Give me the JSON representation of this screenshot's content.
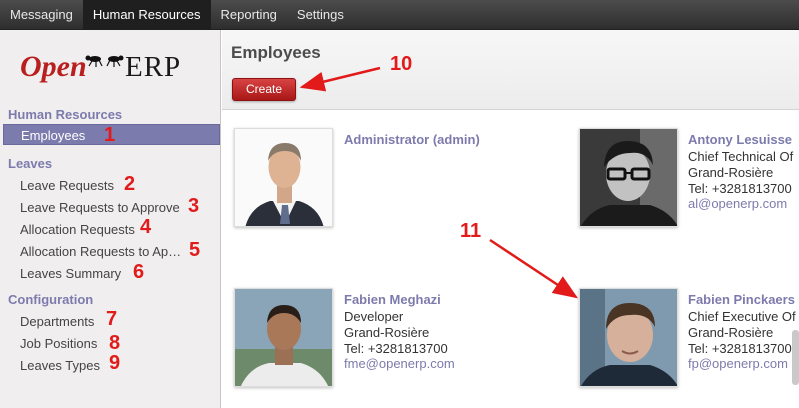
{
  "topbar": {
    "items": [
      {
        "label": "Messaging"
      },
      {
        "label": "Human Resources"
      },
      {
        "label": "Reporting"
      },
      {
        "label": "Settings"
      }
    ]
  },
  "logo": {
    "open": "Open",
    "erp": "ERP"
  },
  "sidebar": {
    "sections": [
      {
        "title": "Human Resources",
        "items": [
          {
            "label": "Employees",
            "marker": "1"
          }
        ]
      },
      {
        "title": "Leaves",
        "items": [
          {
            "label": "Leave Requests",
            "marker": "2"
          },
          {
            "label": "Leave Requests to Approve",
            "marker": "3"
          },
          {
            "label": "Allocation Requests",
            "marker": "4"
          },
          {
            "label": "Allocation Requests to Ap…",
            "marker": "5"
          },
          {
            "label": "Leaves Summary",
            "marker": "6"
          }
        ]
      },
      {
        "title": "Configuration",
        "items": [
          {
            "label": "Departments",
            "marker": "7"
          },
          {
            "label": "Job Positions",
            "marker": "8"
          },
          {
            "label": "Leaves Types",
            "marker": "9"
          }
        ]
      }
    ]
  },
  "main": {
    "title": "Employees",
    "create_label": "Create",
    "create_marker": "10",
    "card_marker": "11"
  },
  "employees": [
    {
      "name": "Administrator (admin)",
      "job": "",
      "location": "",
      "phone": "",
      "email": ""
    },
    {
      "name": "Antony Lesuisse",
      "job": "Chief Technical Of",
      "location": "Grand-Rosière",
      "phone": "Tel: +3281813700",
      "email": "al@openerp.com"
    },
    {
      "name": "Fabien Meghazi",
      "job": "Developer",
      "location": "Grand-Rosière",
      "phone": "Tel: +3281813700",
      "email": "fme@openerp.com"
    },
    {
      "name": "Fabien Pinckaers",
      "job": "Chief Executive Of",
      "location": "Grand-Rosière",
      "phone": "Tel: +3281813700",
      "email": "fp@openerp.com"
    }
  ],
  "colors": {
    "accent": "#7c7bad",
    "brand_red": "#b91f1f",
    "annotation": "#e21a1a"
  }
}
